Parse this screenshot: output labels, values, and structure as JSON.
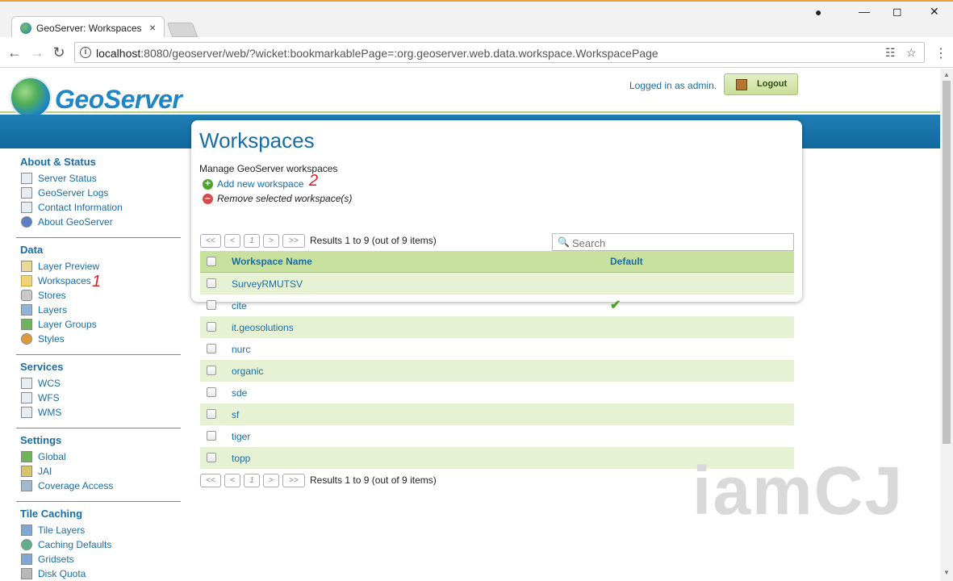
{
  "browser": {
    "tab_title": "GeoServer: Workspaces",
    "tab_close": "×",
    "url_host": "localhost",
    "url_rest": ":8080/geoserver/web/?wicket:bookmarkablePage=:org.geoserver.web.data.workspace.WorkspacePage"
  },
  "header": {
    "logo_text": "GeoServer",
    "logged_in": "Logged in as admin.",
    "logout_label": "Logout"
  },
  "sidebar": {
    "sections": [
      {
        "title": "About & Status",
        "items": [
          "Server Status",
          "GeoServer Logs",
          "Contact Information",
          "About GeoServer"
        ]
      },
      {
        "title": "Data",
        "items": [
          "Layer Preview",
          "Workspaces",
          "Stores",
          "Layers",
          "Layer Groups",
          "Styles"
        ]
      },
      {
        "title": "Services",
        "items": [
          "WCS",
          "WFS",
          "WMS"
        ]
      },
      {
        "title": "Settings",
        "items": [
          "Global",
          "JAI",
          "Coverage Access"
        ]
      },
      {
        "title": "Tile Caching",
        "items": [
          "Tile Layers",
          "Caching Defaults",
          "Gridsets",
          "Disk Quota"
        ]
      }
    ]
  },
  "annotations": {
    "one": "1",
    "two": "2"
  },
  "main": {
    "title": "Workspaces",
    "description": "Manage GeoServer workspaces",
    "add_label": "Add new workspace",
    "remove_label": "Remove selected workspace(s)"
  },
  "pager": {
    "first": "<<",
    "prev": "<",
    "page": "1",
    "next": ">",
    "last": ">>",
    "results": "Results 1 to 9 (out of 9 items)"
  },
  "search": {
    "placeholder": "Search"
  },
  "table": {
    "headers": {
      "name": "Workspace Name",
      "default": "Default"
    },
    "rows": [
      {
        "name": "SurveyRMUTSV",
        "default": ""
      },
      {
        "name": "cite",
        "default": "✔"
      },
      {
        "name": "it.geosolutions",
        "default": ""
      },
      {
        "name": "nurc",
        "default": ""
      },
      {
        "name": "organic",
        "default": ""
      },
      {
        "name": "sde",
        "default": ""
      },
      {
        "name": "sf",
        "default": ""
      },
      {
        "name": "tiger",
        "default": ""
      },
      {
        "name": "topp",
        "default": ""
      }
    ]
  },
  "watermark": "iamCJ",
  "colors": {
    "accent_blue": "#1a6da3",
    "band_blue": "#1f7fb5",
    "row_green": "#e7f2d5",
    "header_green": "#c9e19f"
  }
}
